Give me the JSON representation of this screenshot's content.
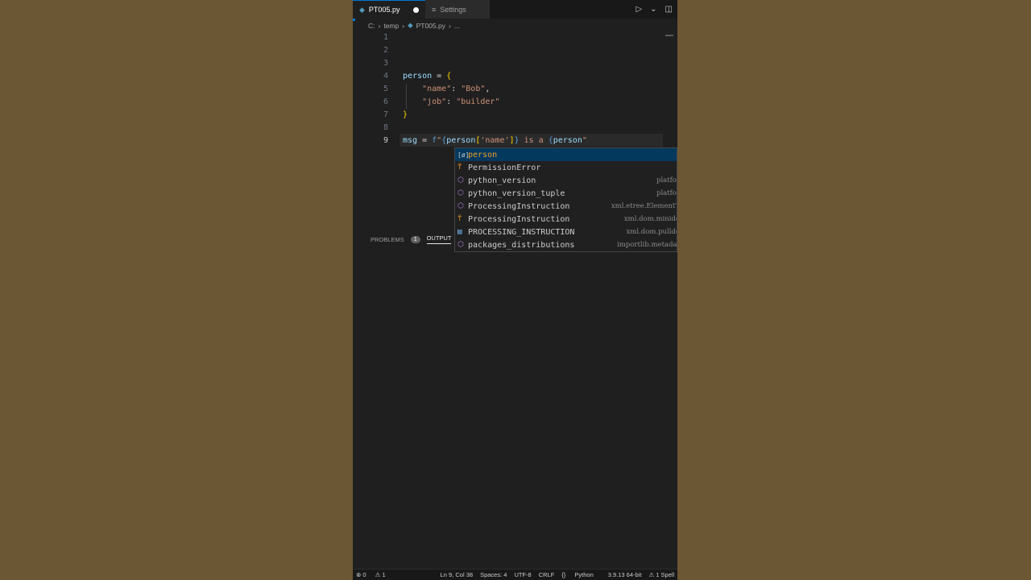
{
  "tabs": [
    {
      "label": "PT005.py",
      "modified": true
    },
    {
      "label": "Settings"
    }
  ],
  "breadcrumb": [
    "C:",
    "temp",
    "PT005.py",
    "..."
  ],
  "editor": {
    "lines": [
      {
        "num": "1"
      },
      {
        "num": "2"
      },
      {
        "num": "3"
      },
      {
        "num": "4",
        "tokens": [
          [
            "var",
            "person"
          ],
          [
            "op",
            " = "
          ],
          [
            "br",
            "{"
          ]
        ]
      },
      {
        "num": "5",
        "tokens": [
          [
            "op",
            "    "
          ],
          [
            "str",
            "\"name\""
          ],
          [
            "op",
            ": "
          ],
          [
            "str",
            "\"Bob\""
          ],
          [
            "op",
            ","
          ]
        ]
      },
      {
        "num": "6",
        "tokens": [
          [
            "op",
            "    "
          ],
          [
            "str",
            "\"job\""
          ],
          [
            "op",
            ": "
          ],
          [
            "str",
            "\"builder\""
          ]
        ]
      },
      {
        "num": "7",
        "tokens": [
          [
            "br",
            "}"
          ]
        ]
      },
      {
        "num": "8"
      },
      {
        "num": "9",
        "tokens": [
          [
            "var",
            "msg"
          ],
          [
            "op",
            " = "
          ],
          [
            "fs",
            "f"
          ],
          [
            "str",
            "\""
          ],
          [
            "fs",
            "{"
          ],
          [
            "var",
            "person"
          ],
          [
            "br",
            "["
          ],
          [
            "str",
            "'name'"
          ],
          [
            "br",
            "]"
          ],
          [
            "fs",
            "}"
          ],
          [
            "str",
            " is a "
          ],
          [
            "fs",
            "{"
          ],
          [
            "var",
            "person"
          ],
          [
            "str",
            "\""
          ]
        ]
      }
    ]
  },
  "suggestions": [
    {
      "label": "person",
      "kind": "variable",
      "detail": ""
    },
    {
      "label": "PermissionError",
      "kind": "class",
      "detail": ""
    },
    {
      "label": "python_version",
      "kind": "module",
      "detail": "platfor"
    },
    {
      "label": "python_version_tuple",
      "kind": "module",
      "detail": "platfor"
    },
    {
      "label": "ProcessingInstruction",
      "kind": "module",
      "detail": "xml.etree.ElementT"
    },
    {
      "label": "ProcessingInstruction",
      "kind": "class",
      "detail": "xml.dom.minido"
    },
    {
      "label": "PROCESSING_INSTRUCTION",
      "kind": "constant",
      "detail": "xml.dom.pulldo"
    },
    {
      "label": "packages_distributions",
      "kind": "module",
      "detail": "importlib.metadat"
    }
  ],
  "panel": {
    "problems_label": "PROBLEMS",
    "problems_count": "1",
    "output_label": "OUTPUT"
  },
  "status": {
    "errors": "0",
    "warnings": "1",
    "position": "Ln 9, Col 38",
    "spaces": "Spaces: 4",
    "encoding": "UTF-8",
    "eol": "CRLF",
    "language": "Python",
    "interpreter": "3.9.13 64-bit",
    "spell": "1 Spell"
  }
}
